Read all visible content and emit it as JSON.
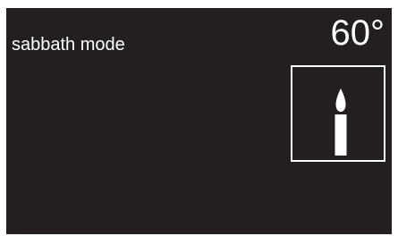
{
  "display": {
    "mode_label": "sabbath mode",
    "temperature": "60°"
  },
  "candle_button": {
    "icon": "candle-icon"
  },
  "colors": {
    "screen_background": "#231f20",
    "foreground": "#ffffff"
  }
}
